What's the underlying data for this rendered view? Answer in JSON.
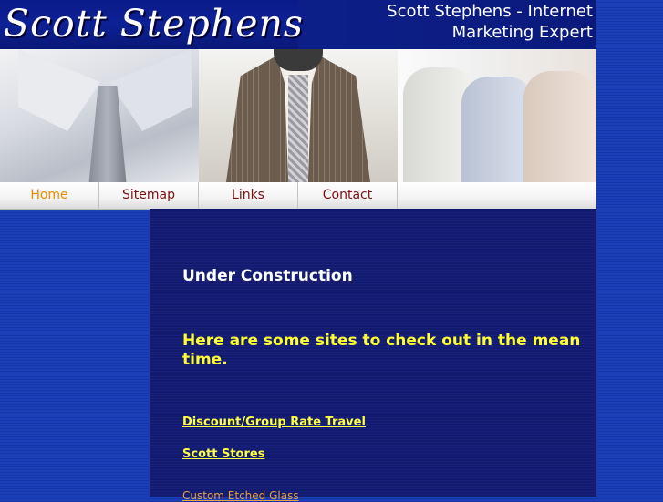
{
  "header": {
    "logo_text": "Scott Stephens",
    "tagline": "Scott Stephens - Internet Marketing Expert"
  },
  "nav": {
    "items": [
      {
        "label": "Home",
        "active": true
      },
      {
        "label": "Sitemap",
        "active": false
      },
      {
        "label": "Links",
        "active": false
      },
      {
        "label": "Contact",
        "active": false
      }
    ]
  },
  "content": {
    "heading": "Under Construction",
    "intro": "Here are some sites to check out in the mean time.",
    "links": [
      "Discount/Group Rate Travel",
      "Scott Stores",
      "Custom Etched Glass"
    ]
  },
  "colors": {
    "page_background": "#1a3fb8",
    "content_background": "#131b6e",
    "nav_active": "#f08a00",
    "nav_text": "#7a1010",
    "intro_text": "#ffff33",
    "link_text": "#ffff44"
  }
}
